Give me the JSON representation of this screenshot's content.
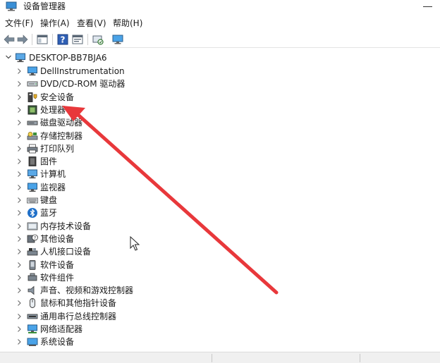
{
  "window": {
    "title": "设备管理器",
    "icon": "device-manager-icon"
  },
  "menu": [
    {
      "label": "文件(F)"
    },
    {
      "label": "操作(A)"
    },
    {
      "label": "查看(V)"
    },
    {
      "label": "帮助(H)"
    }
  ],
  "toolbar": {
    "buttons": [
      "back-icon",
      "forward-icon",
      "show-hide-console-tree-icon",
      "help-icon",
      "properties-icon",
      "scan-hardware-icon",
      "monitor-icon"
    ]
  },
  "tree": {
    "root": {
      "label": "DESKTOP-BB7BJA6",
      "icon": "computer-icon",
      "expanded": true
    },
    "items": [
      {
        "label": "DellInstrumentation",
        "icon": "monitor-icon"
      },
      {
        "label": "DVD/CD-ROM 驱动器",
        "icon": "dvd-drive-icon"
      },
      {
        "label": "安全设备",
        "icon": "security-device-icon"
      },
      {
        "label": "处理器",
        "icon": "processor-icon"
      },
      {
        "label": "磁盘驱动器",
        "icon": "disk-drive-icon"
      },
      {
        "label": "存储控制器",
        "icon": "storage-controller-icon"
      },
      {
        "label": "打印队列",
        "icon": "printer-icon"
      },
      {
        "label": "固件",
        "icon": "firmware-icon"
      },
      {
        "label": "计算机",
        "icon": "computer-icon"
      },
      {
        "label": "监视器",
        "icon": "monitor-icon"
      },
      {
        "label": "键盘",
        "icon": "keyboard-icon"
      },
      {
        "label": "蓝牙",
        "icon": "bluetooth-icon"
      },
      {
        "label": "内存技术设备",
        "icon": "memory-device-icon"
      },
      {
        "label": "其他设备",
        "icon": "other-device-icon"
      },
      {
        "label": "人机接口设备",
        "icon": "hid-icon"
      },
      {
        "label": "软件设备",
        "icon": "software-device-icon"
      },
      {
        "label": "软件组件",
        "icon": "software-component-icon"
      },
      {
        "label": "声音、视频和游戏控制器",
        "icon": "speaker-icon"
      },
      {
        "label": "鼠标和其他指针设备",
        "icon": "mouse-icon"
      },
      {
        "label": "通用串行总线控制器",
        "icon": "usb-icon"
      },
      {
        "label": "网络适配器",
        "icon": "network-adapter-icon"
      },
      {
        "label": "系统设备",
        "icon": "system-device-icon"
      }
    ]
  },
  "annotation": {
    "arrow_color": "#e8383b",
    "points_to": "处理器"
  },
  "colors": {
    "accent": "#1e6fc8",
    "chevron": "#6a6a6a"
  }
}
